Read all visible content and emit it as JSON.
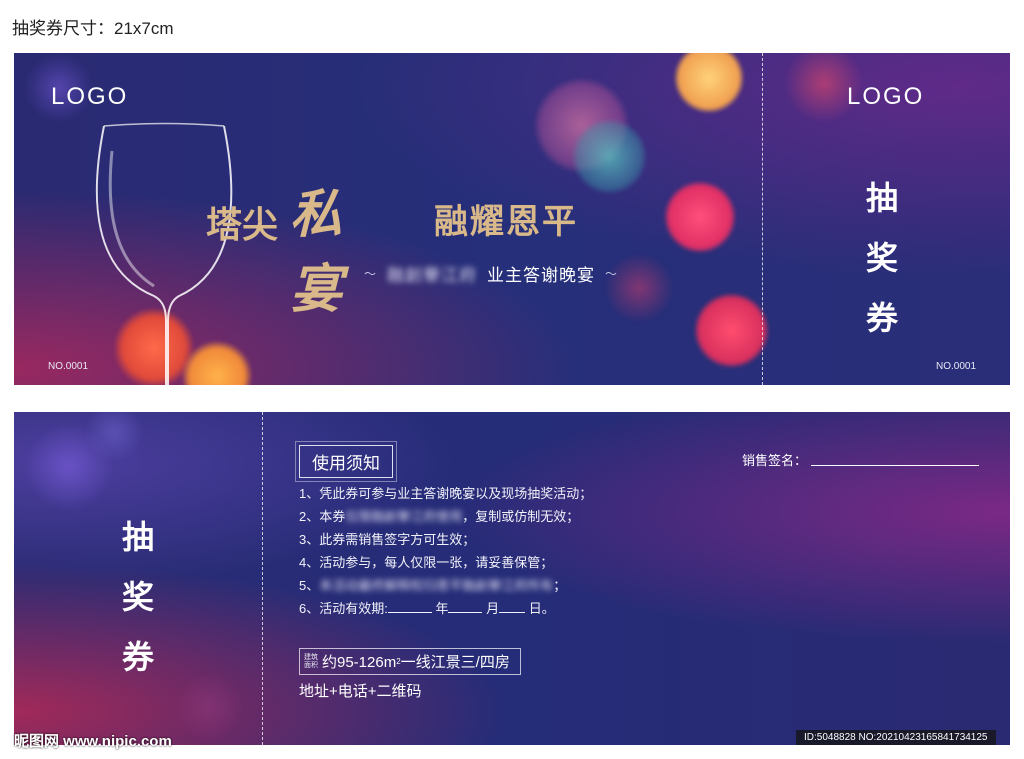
{
  "size_note": "抽奖券尺寸：21x7cm",
  "front": {
    "logo_left": "LOGO",
    "logo_right": "LOGO",
    "title_part1": "塔尖",
    "title_part2": "私宴",
    "title_part3": "融耀恩平",
    "subtitle_blurred": "融創譽江府",
    "subtitle": "业主答谢晚宴",
    "stub_chars": [
      "抽",
      "奖",
      "券"
    ],
    "number_left": "NO.0001",
    "number_right": "NO.0001"
  },
  "back": {
    "stub_chars": [
      "抽",
      "奖",
      "券"
    ],
    "notice_title": "使用须知",
    "rules": {
      "r1": "1、凭此券可参与业主答谢晚宴以及现场抽奖活动；",
      "r2_prefix": "2、本券",
      "r2_blurred": "仅限融創譽江府使用",
      "r2_suffix": "，复制或仿制无效；",
      "r3": "3、此券需销售签字方可生效；",
      "r4": "4、活动参与，每人仅限一张，请妥善保管；",
      "r5_prefix": "5、",
      "r5_blurred": "本活动最终解释权归恩平融創譽江府所有",
      "r5_suffix": "；",
      "r6_prefix": "6、活动有效期:",
      "r6_year": "年",
      "r6_month": "月",
      "r6_day": "日。"
    },
    "area_small": "建筑面积",
    "area_main": "约95-126m",
    "area_sup": "2",
    "area_rest": "一线江景三/四房",
    "contact": "地址+电话+二维码",
    "sign_label": "销售签名："
  },
  "watermark": {
    "left": "昵图网 www.nipic.com",
    "right": "ID:5048828 NO:20210423165841734125"
  }
}
